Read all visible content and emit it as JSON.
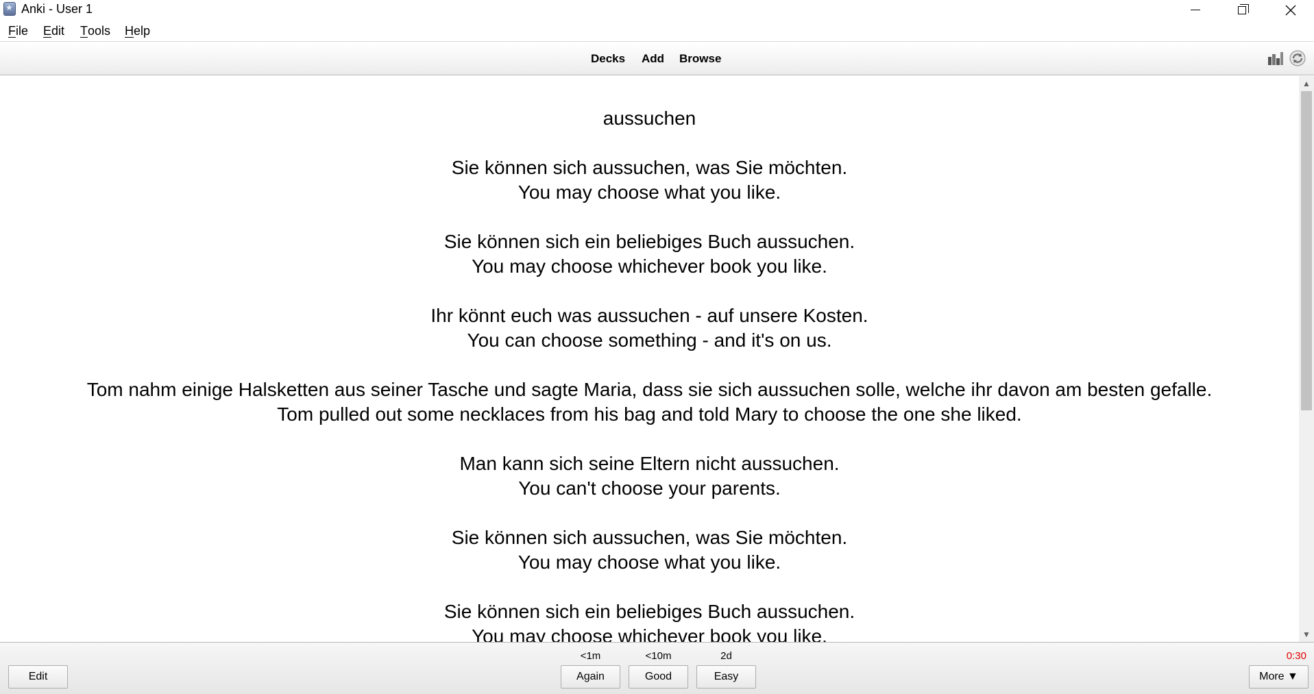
{
  "window": {
    "title": "Anki - User 1",
    "controls": {
      "minimize": "minimize-icon",
      "maximize": "restore-icon",
      "close": "close-icon"
    }
  },
  "menu": {
    "items": [
      {
        "first": "F",
        "rest": "ile"
      },
      {
        "first": "E",
        "rest": "dit"
      },
      {
        "first": "T",
        "rest": "ools"
      },
      {
        "first": "H",
        "rest": "elp"
      }
    ]
  },
  "toolbar": {
    "decks": "Decks",
    "add": "Add",
    "browse": "Browse",
    "icons": [
      "stats-icon",
      "sync-icon"
    ]
  },
  "card": {
    "front": "aussuchen",
    "examples": [
      {
        "de": "Sie können sich aussuchen, was Sie möchten.",
        "en": "You may choose what you like."
      },
      {
        "de": "Sie können sich ein beliebiges Buch aussuchen.",
        "en": "You may choose whichever book you like."
      },
      {
        "de": "Ihr könnt euch was aussuchen - auf unsere Kosten.",
        "en": "You can choose something - and it's on us."
      },
      {
        "de": "Tom nahm einige Halsketten aus seiner Tasche und sagte Maria, dass sie sich aussuchen solle, welche ihr davon am besten gefalle.",
        "en": "Tom pulled out some necklaces from his bag and told Mary to choose the one she liked."
      },
      {
        "de": "Man kann sich seine Eltern nicht aussuchen.",
        "en": "You can't choose your parents."
      },
      {
        "de": "Sie können sich aussuchen, was Sie möchten.",
        "en": "You may choose what you like."
      },
      {
        "de": "Sie können sich ein beliebiges Buch aussuchen.",
        "en": "You may choose whichever book you like."
      }
    ]
  },
  "bottom": {
    "edit": "Edit",
    "again": {
      "label": "Again",
      "interval": "<1m"
    },
    "good": {
      "label": "Good",
      "interval": "<10m"
    },
    "easy": {
      "label": "Easy",
      "interval": "2d"
    },
    "more": "More ▼",
    "timer": "0:30",
    "timer_color": "#e00000"
  }
}
